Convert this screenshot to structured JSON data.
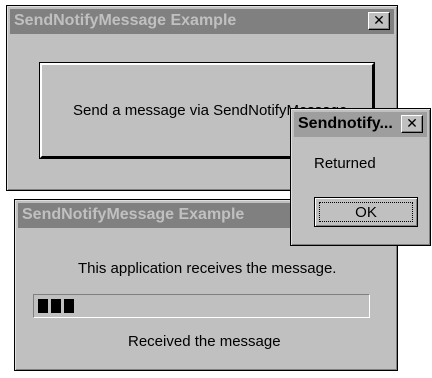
{
  "sender_window": {
    "title": "SendNotifyMessage Example",
    "close_glyph": "✕",
    "send_button_label": "Send a message via SendNotifyMessage"
  },
  "receiver_window": {
    "title": "SendNotifyMessage Example",
    "info_text": "This application receives the message.",
    "progress": {
      "blocks_filled": 3
    },
    "status_text": "Received the message"
  },
  "dialog": {
    "title": "Sendnotify...",
    "close_glyph": "✕",
    "message": "Returned",
    "ok_label": "OK"
  },
  "colors": {
    "window_face": "#c0c0c0",
    "inactive_titlebar": "#808080",
    "active_titlebar": "#9e9e9e",
    "progress_block": "#000000"
  }
}
